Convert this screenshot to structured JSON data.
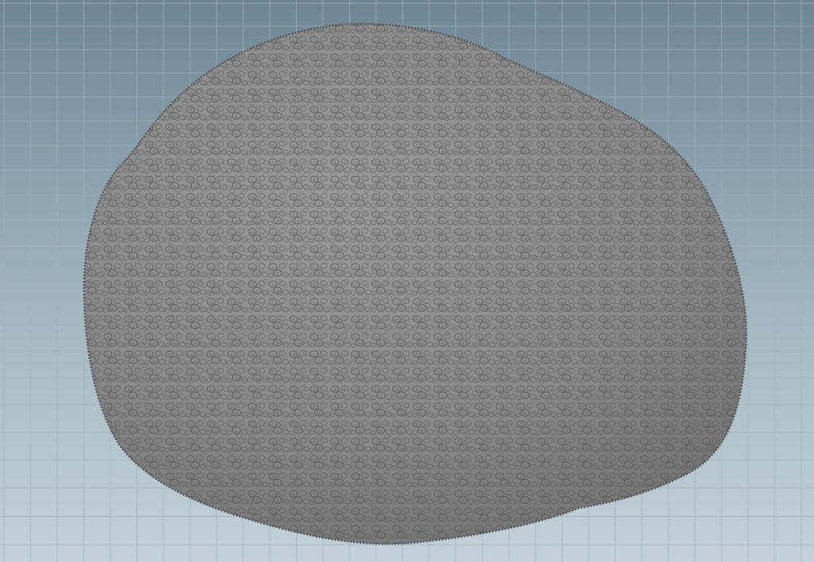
{
  "viewport": {
    "background_top": "#6e8593",
    "background_bottom": "#c4d1d8",
    "grid_color": "#9fb2bd",
    "grid_visible": true
  },
  "object": {
    "type": "porous-rock-mesh",
    "surface_color": "#8c8c8c",
    "pore_color": "#5a5a5a",
    "highlight_color": "#a6a6a6"
  }
}
